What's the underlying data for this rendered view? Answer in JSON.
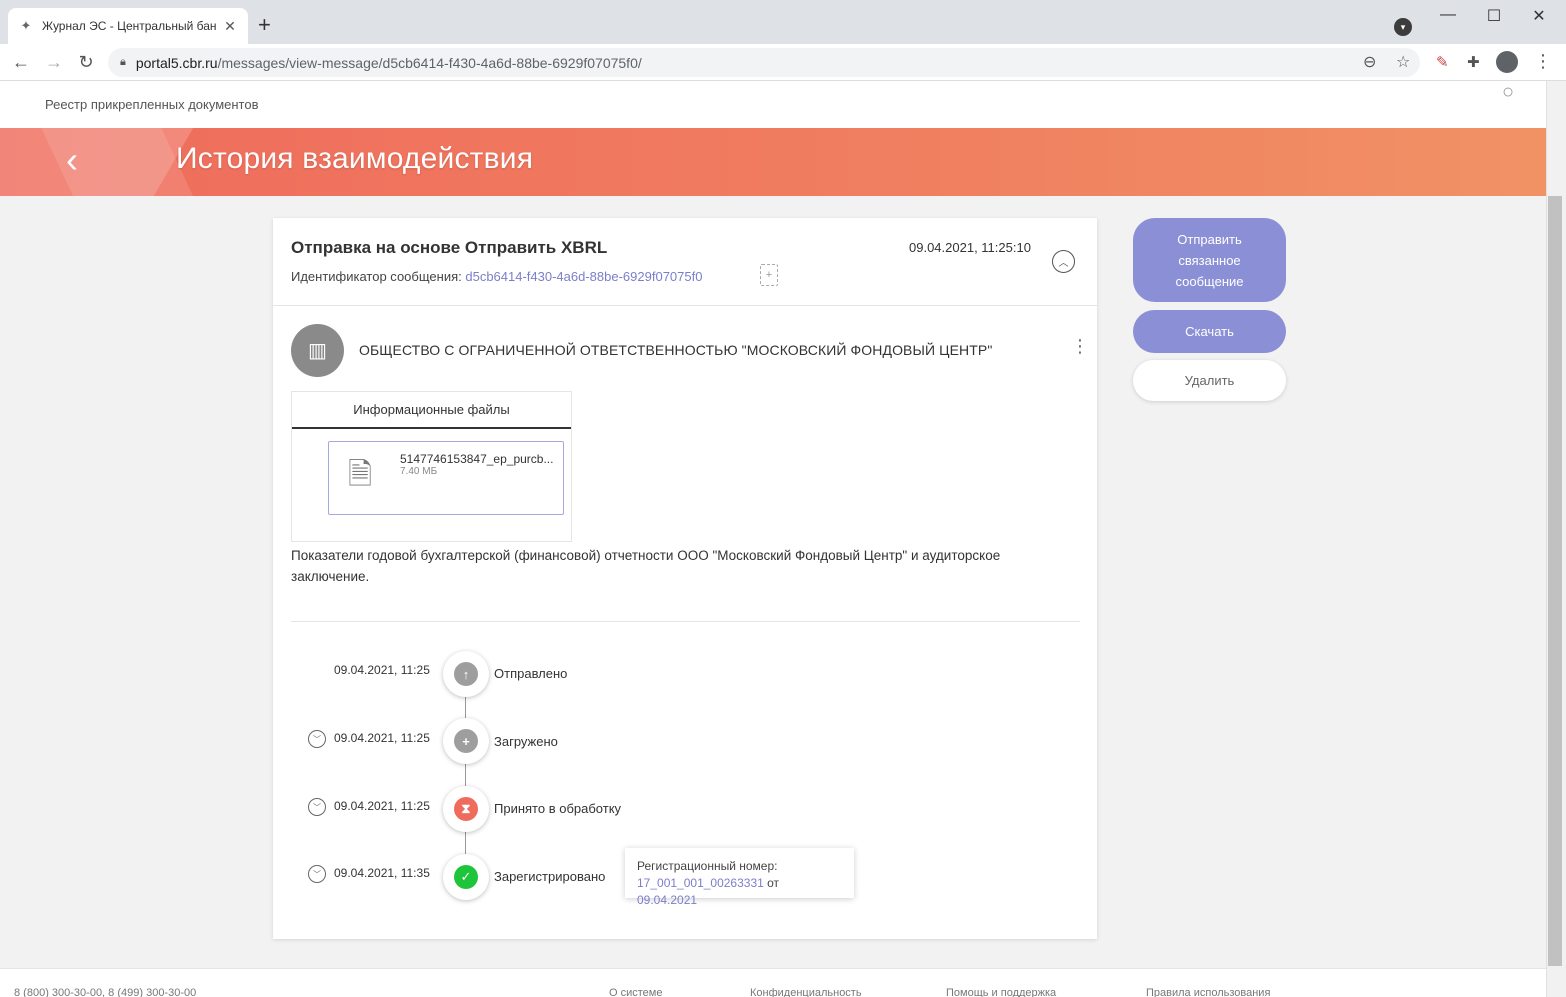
{
  "browser": {
    "tab_title": "Журнал ЭС - Центральный бан",
    "url_host": "portal5.cbr.ru",
    "url_path": "/messages/view-message/d5cb6414-f430-4a6d-88be-6929f07075f0/"
  },
  "topnav": {
    "link": "Реестр прикрепленных документов"
  },
  "banner": {
    "title": "История взаимодействия"
  },
  "message": {
    "title": "Отправка на основе Отправить XBRL",
    "date": "09.04.2021, 11:25:10",
    "id_label": "Идентификатор сообщения: ",
    "id_value": "d5cb6414-f430-4a6d-88be-6929f07075f0",
    "org_name": "ОБЩЕСТВО С ОГРАНИЧЕННОЙ ОТВЕТСТВЕННОСТЬЮ \"МОСКОВСКИЙ ФОНДОВЫЙ ЦЕНТР\"",
    "files_tab": "Информационные файлы",
    "file_name": "5147746153847_ep_purcb...",
    "file_size": "7.40 МБ",
    "description": "Показатели годовой бухгалтерской (финансовой) отчетности ООО \"Московский Фондовый Центр\" и аудиторское заключение."
  },
  "timeline": [
    {
      "date": "09.04.2021, 11:25",
      "status": "Отправлено",
      "icon": "arrow-up-icon",
      "color": "#9e9e9e"
    },
    {
      "date": "09.04.2021, 11:25",
      "status": "Загружено",
      "icon": "plus-icon",
      "color": "#9e9e9e"
    },
    {
      "date": "09.04.2021, 11:25",
      "status": "Принято в обработку",
      "icon": "hourglass-icon",
      "color": "#ef6b5c"
    },
    {
      "date": "09.04.2021, 11:35",
      "status": "Зарегистрировано",
      "icon": "check-icon",
      "color": "#1ec53a"
    }
  ],
  "registration": {
    "label": "Регистрационный номер:",
    "number": "17_001_001_00263331",
    "from": " от ",
    "date": "09.04.2021"
  },
  "actions": {
    "related": "Отправить связанное сообщение",
    "download": "Скачать",
    "delete": "Удалить"
  },
  "footer": {
    "phones": "8 (800) 300-30-00, 8 (499) 300-30-00",
    "about": "О системе",
    "privacy": "Конфиденциальность",
    "help": "Помощь и поддержка",
    "terms": "Правила использования"
  }
}
